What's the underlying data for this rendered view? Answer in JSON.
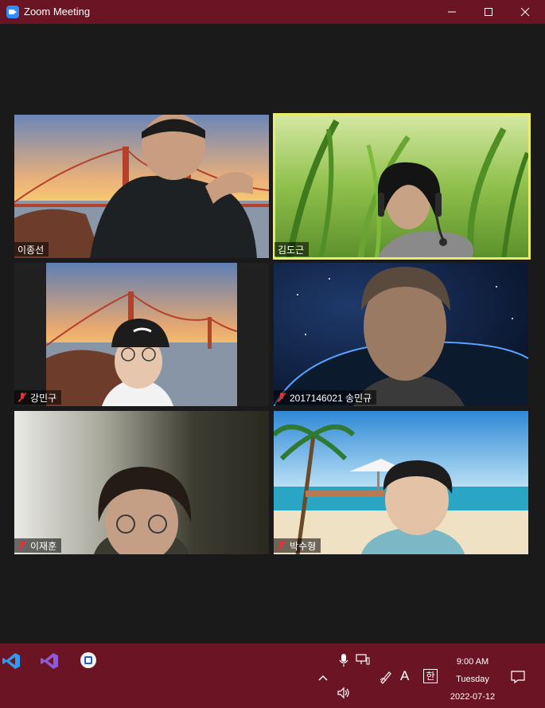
{
  "window": {
    "title": "Zoom Meeting"
  },
  "participants": [
    {
      "name": "이종선",
      "muted": false,
      "active": false
    },
    {
      "name": "김도근",
      "muted": false,
      "active": true
    },
    {
      "name": "강민구",
      "muted": true,
      "active": false
    },
    {
      "name": "2017146021 송민규",
      "muted": true,
      "active": false
    },
    {
      "name": "이재훈",
      "muted": true,
      "active": false
    },
    {
      "name": "박수형",
      "muted": true,
      "active": false
    }
  ],
  "taskbar": {
    "time": "9:00 AM",
    "day": "Tuesday",
    "date": "2022-07-12",
    "ime_font": "A",
    "ime_lang": "한"
  },
  "colors": {
    "titlebar": "#6b1524",
    "active_border": "#e8ec6a",
    "muted_icon": "#e0323b"
  }
}
